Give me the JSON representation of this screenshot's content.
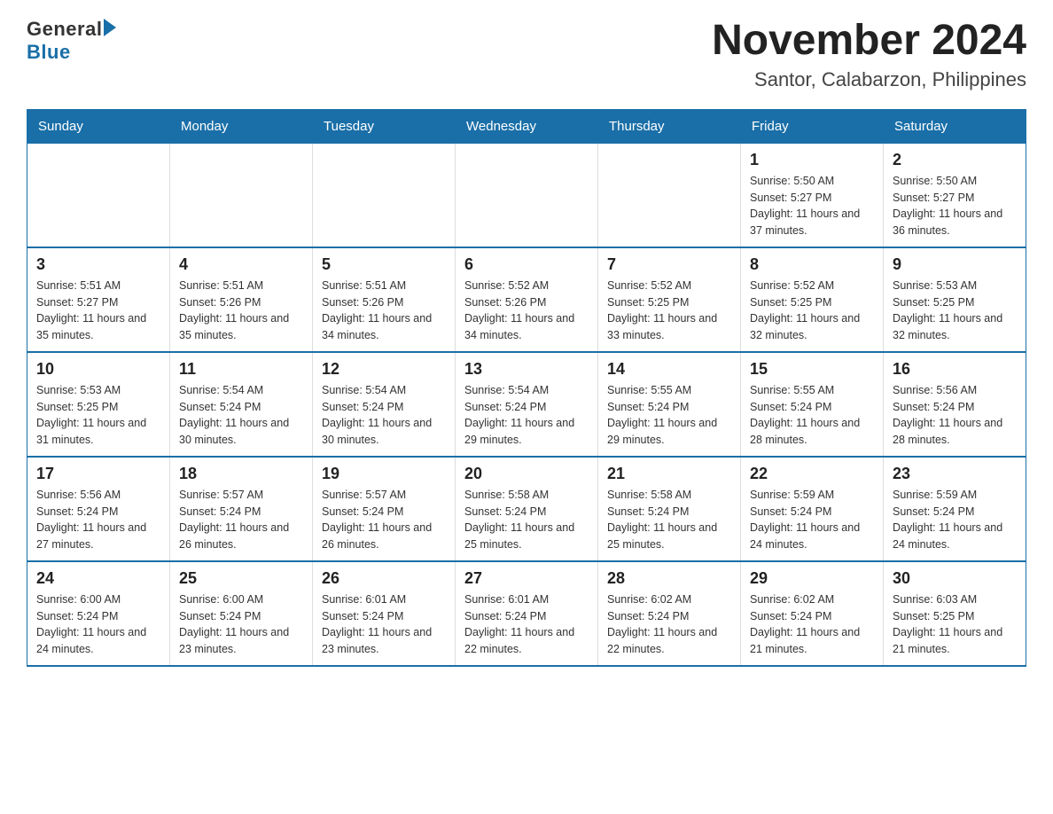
{
  "header": {
    "logo_general": "General",
    "logo_blue": "Blue",
    "title": "November 2024",
    "subtitle": "Santor, Calabarzon, Philippines"
  },
  "weekdays": [
    "Sunday",
    "Monday",
    "Tuesday",
    "Wednesday",
    "Thursday",
    "Friday",
    "Saturday"
  ],
  "weeks": [
    [
      {
        "day": "",
        "sunrise": "",
        "sunset": "",
        "daylight": ""
      },
      {
        "day": "",
        "sunrise": "",
        "sunset": "",
        "daylight": ""
      },
      {
        "day": "",
        "sunrise": "",
        "sunset": "",
        "daylight": ""
      },
      {
        "day": "",
        "sunrise": "",
        "sunset": "",
        "daylight": ""
      },
      {
        "day": "",
        "sunrise": "",
        "sunset": "",
        "daylight": ""
      },
      {
        "day": "1",
        "sunrise": "Sunrise: 5:50 AM",
        "sunset": "Sunset: 5:27 PM",
        "daylight": "Daylight: 11 hours and 37 minutes."
      },
      {
        "day": "2",
        "sunrise": "Sunrise: 5:50 AM",
        "sunset": "Sunset: 5:27 PM",
        "daylight": "Daylight: 11 hours and 36 minutes."
      }
    ],
    [
      {
        "day": "3",
        "sunrise": "Sunrise: 5:51 AM",
        "sunset": "Sunset: 5:27 PM",
        "daylight": "Daylight: 11 hours and 35 minutes."
      },
      {
        "day": "4",
        "sunrise": "Sunrise: 5:51 AM",
        "sunset": "Sunset: 5:26 PM",
        "daylight": "Daylight: 11 hours and 35 minutes."
      },
      {
        "day": "5",
        "sunrise": "Sunrise: 5:51 AM",
        "sunset": "Sunset: 5:26 PM",
        "daylight": "Daylight: 11 hours and 34 minutes."
      },
      {
        "day": "6",
        "sunrise": "Sunrise: 5:52 AM",
        "sunset": "Sunset: 5:26 PM",
        "daylight": "Daylight: 11 hours and 34 minutes."
      },
      {
        "day": "7",
        "sunrise": "Sunrise: 5:52 AM",
        "sunset": "Sunset: 5:25 PM",
        "daylight": "Daylight: 11 hours and 33 minutes."
      },
      {
        "day": "8",
        "sunrise": "Sunrise: 5:52 AM",
        "sunset": "Sunset: 5:25 PM",
        "daylight": "Daylight: 11 hours and 32 minutes."
      },
      {
        "day": "9",
        "sunrise": "Sunrise: 5:53 AM",
        "sunset": "Sunset: 5:25 PM",
        "daylight": "Daylight: 11 hours and 32 minutes."
      }
    ],
    [
      {
        "day": "10",
        "sunrise": "Sunrise: 5:53 AM",
        "sunset": "Sunset: 5:25 PM",
        "daylight": "Daylight: 11 hours and 31 minutes."
      },
      {
        "day": "11",
        "sunrise": "Sunrise: 5:54 AM",
        "sunset": "Sunset: 5:24 PM",
        "daylight": "Daylight: 11 hours and 30 minutes."
      },
      {
        "day": "12",
        "sunrise": "Sunrise: 5:54 AM",
        "sunset": "Sunset: 5:24 PM",
        "daylight": "Daylight: 11 hours and 30 minutes."
      },
      {
        "day": "13",
        "sunrise": "Sunrise: 5:54 AM",
        "sunset": "Sunset: 5:24 PM",
        "daylight": "Daylight: 11 hours and 29 minutes."
      },
      {
        "day": "14",
        "sunrise": "Sunrise: 5:55 AM",
        "sunset": "Sunset: 5:24 PM",
        "daylight": "Daylight: 11 hours and 29 minutes."
      },
      {
        "day": "15",
        "sunrise": "Sunrise: 5:55 AM",
        "sunset": "Sunset: 5:24 PM",
        "daylight": "Daylight: 11 hours and 28 minutes."
      },
      {
        "day": "16",
        "sunrise": "Sunrise: 5:56 AM",
        "sunset": "Sunset: 5:24 PM",
        "daylight": "Daylight: 11 hours and 28 minutes."
      }
    ],
    [
      {
        "day": "17",
        "sunrise": "Sunrise: 5:56 AM",
        "sunset": "Sunset: 5:24 PM",
        "daylight": "Daylight: 11 hours and 27 minutes."
      },
      {
        "day": "18",
        "sunrise": "Sunrise: 5:57 AM",
        "sunset": "Sunset: 5:24 PM",
        "daylight": "Daylight: 11 hours and 26 minutes."
      },
      {
        "day": "19",
        "sunrise": "Sunrise: 5:57 AM",
        "sunset": "Sunset: 5:24 PM",
        "daylight": "Daylight: 11 hours and 26 minutes."
      },
      {
        "day": "20",
        "sunrise": "Sunrise: 5:58 AM",
        "sunset": "Sunset: 5:24 PM",
        "daylight": "Daylight: 11 hours and 25 minutes."
      },
      {
        "day": "21",
        "sunrise": "Sunrise: 5:58 AM",
        "sunset": "Sunset: 5:24 PM",
        "daylight": "Daylight: 11 hours and 25 minutes."
      },
      {
        "day": "22",
        "sunrise": "Sunrise: 5:59 AM",
        "sunset": "Sunset: 5:24 PM",
        "daylight": "Daylight: 11 hours and 24 minutes."
      },
      {
        "day": "23",
        "sunrise": "Sunrise: 5:59 AM",
        "sunset": "Sunset: 5:24 PM",
        "daylight": "Daylight: 11 hours and 24 minutes."
      }
    ],
    [
      {
        "day": "24",
        "sunrise": "Sunrise: 6:00 AM",
        "sunset": "Sunset: 5:24 PM",
        "daylight": "Daylight: 11 hours and 24 minutes."
      },
      {
        "day": "25",
        "sunrise": "Sunrise: 6:00 AM",
        "sunset": "Sunset: 5:24 PM",
        "daylight": "Daylight: 11 hours and 23 minutes."
      },
      {
        "day": "26",
        "sunrise": "Sunrise: 6:01 AM",
        "sunset": "Sunset: 5:24 PM",
        "daylight": "Daylight: 11 hours and 23 minutes."
      },
      {
        "day": "27",
        "sunrise": "Sunrise: 6:01 AM",
        "sunset": "Sunset: 5:24 PM",
        "daylight": "Daylight: 11 hours and 22 minutes."
      },
      {
        "day": "28",
        "sunrise": "Sunrise: 6:02 AM",
        "sunset": "Sunset: 5:24 PM",
        "daylight": "Daylight: 11 hours and 22 minutes."
      },
      {
        "day": "29",
        "sunrise": "Sunrise: 6:02 AM",
        "sunset": "Sunset: 5:24 PM",
        "daylight": "Daylight: 11 hours and 21 minutes."
      },
      {
        "day": "30",
        "sunrise": "Sunrise: 6:03 AM",
        "sunset": "Sunset: 5:25 PM",
        "daylight": "Daylight: 11 hours and 21 minutes."
      }
    ]
  ]
}
